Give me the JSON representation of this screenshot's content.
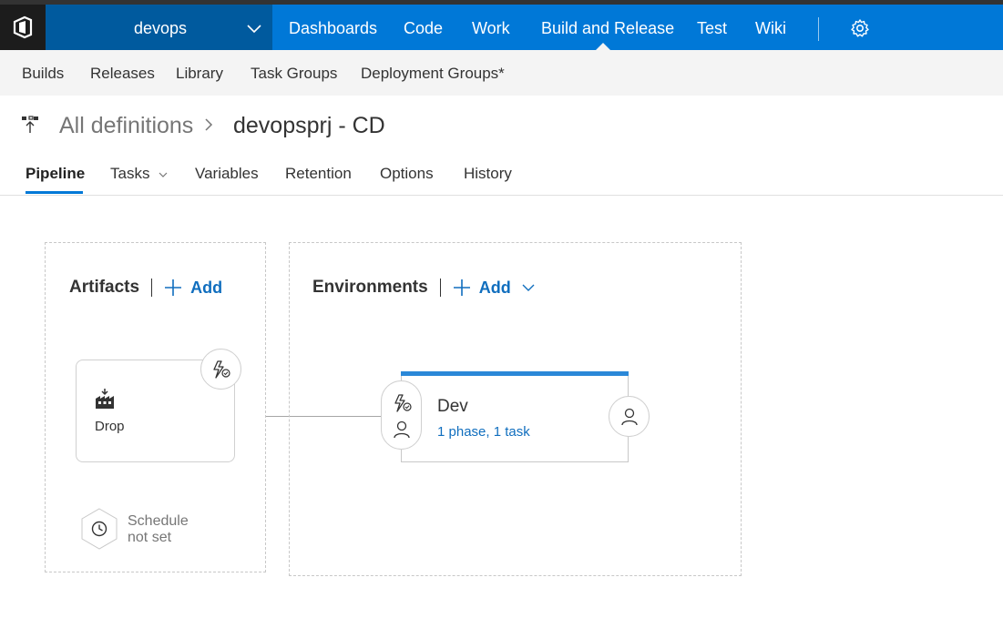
{
  "top_nav": {
    "project": "devops",
    "items": [
      "Dashboards",
      "Code",
      "Work",
      "Build and Release",
      "Test",
      "Wiki"
    ],
    "active": "Build and Release"
  },
  "sub_nav": {
    "items": [
      "Builds",
      "Releases",
      "Library",
      "Task Groups",
      "Deployment Groups*"
    ]
  },
  "breadcrumb": {
    "parent": "All definitions",
    "title": "devopsprj - CD"
  },
  "tabs": {
    "items": [
      "Pipeline",
      "Tasks",
      "Variables",
      "Retention",
      "Options",
      "History"
    ],
    "active": "Pipeline"
  },
  "artifacts": {
    "title": "Artifacts",
    "add_label": "Add",
    "card_label": "Drop",
    "schedule_line1": "Schedule",
    "schedule_line2": "not set"
  },
  "environments": {
    "title": "Environments",
    "add_label": "Add",
    "env_name": "Dev",
    "env_detail": "1 phase, 1 task"
  },
  "colors": {
    "brand_blue": "#0078d7",
    "project_blue": "#005a9e",
    "link_blue": "#106ebe"
  }
}
